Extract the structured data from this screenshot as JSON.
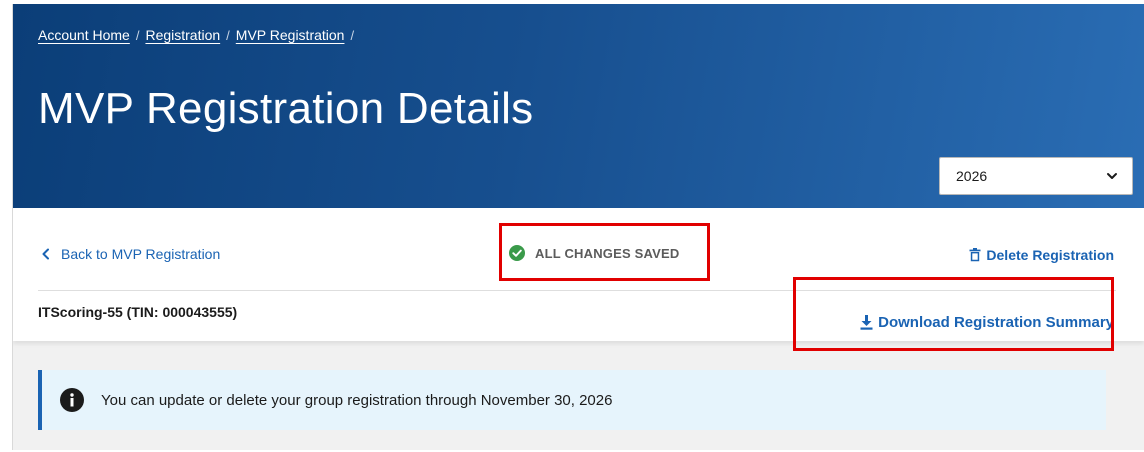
{
  "breadcrumb": {
    "items": [
      "Account Home",
      "Registration",
      "MVP Registration"
    ],
    "separator": "/"
  },
  "header": {
    "title": "MVP Registration Details"
  },
  "year_select": {
    "value": "2026"
  },
  "toolbar": {
    "back_label": "Back to MVP Registration",
    "status_label": "ALL CHANGES SAVED",
    "delete_label": "Delete Registration",
    "download_label": "Download Registration Summary"
  },
  "entity": {
    "label": "ITScoring-55 (TIN: 000043555)"
  },
  "alert": {
    "message": "You can update or delete your group registration through November 30, 2026"
  },
  "colors": {
    "hero_dark": "#0b3e78",
    "hero_light": "#2a6db4",
    "link": "#1a63b3",
    "success": "#3a9a4a",
    "alert_bg": "#e6f4fc",
    "highlight": "#e10000"
  },
  "icons": {
    "back": "chevron-left-icon",
    "status": "check-circle-icon",
    "delete": "trash-icon",
    "download": "download-icon",
    "alert": "info-icon",
    "select": "chevron-down-icon"
  }
}
